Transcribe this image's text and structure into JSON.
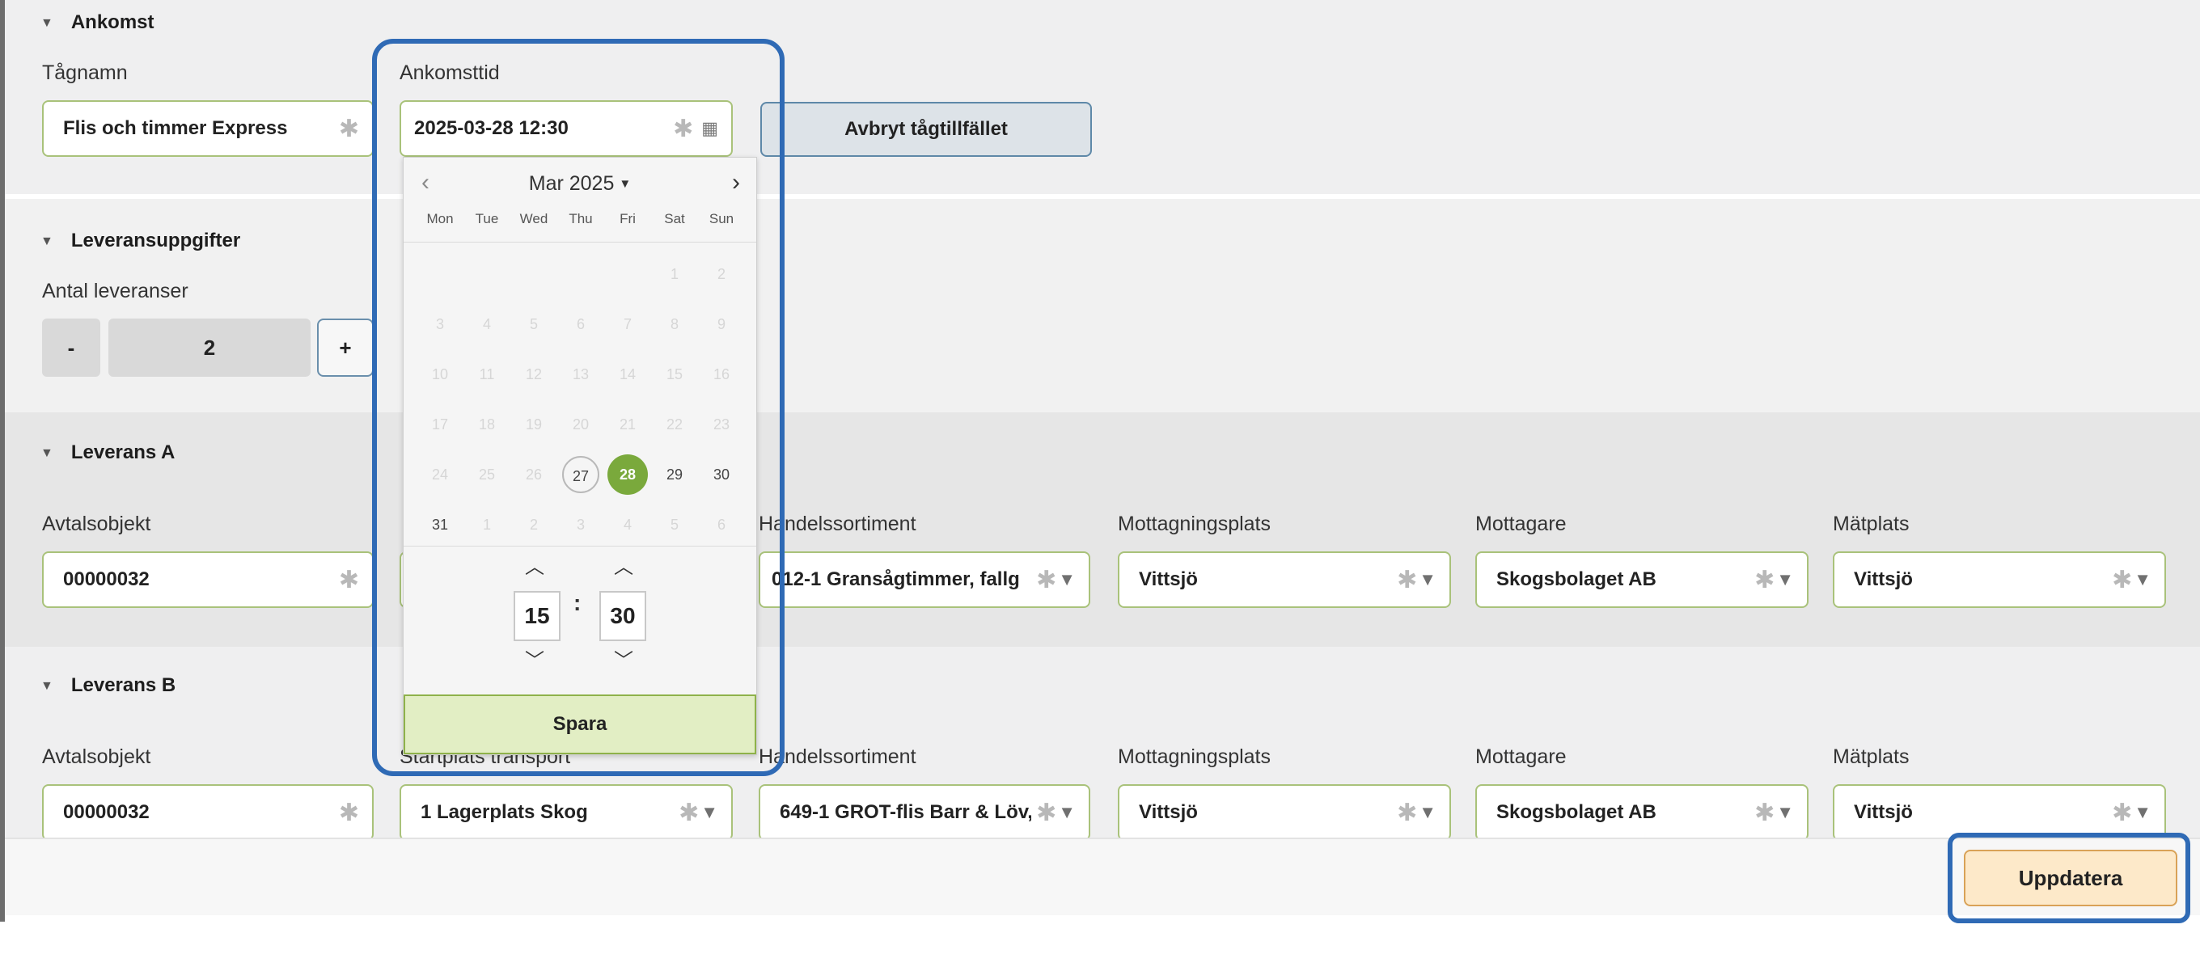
{
  "ankomst": {
    "section_title": "Ankomst",
    "train_name_label": "Tågnamn",
    "train_name_value": "Flis och timmer Express",
    "arrival_time_label": "Ankomsttid",
    "arrival_time_value": "2025-03-28 12:30",
    "cancel_button": "Avbryt tågtillfället"
  },
  "leveransuppgifter": {
    "section_title": "Leveransuppgifter",
    "count_label": "Antal leveranser",
    "minus": "-",
    "count_value": "2",
    "plus": "+"
  },
  "leverans_a": {
    "section_title": "Leverans A",
    "avtalsobjekt_label": "Avtalsobjekt",
    "avtalsobjekt_value": "00000032",
    "handelssortiment_label": "Handelssortiment",
    "handelssortiment_value": "012-1 Gransågtimmer, fallg",
    "mottagningsplats_label": "Mottagningsplats",
    "mottagningsplats_value": "Vittsjö",
    "mottagare_label": "Mottagare",
    "mottagare_value": "Skogsbolaget AB",
    "matplats_label": "Mätplats",
    "matplats_value": "Vittsjö"
  },
  "leverans_b": {
    "section_title": "Leverans B",
    "avtalsobjekt_label": "Avtalsobjekt",
    "avtalsobjekt_value": "00000032",
    "startplats_label": "Startplats transport",
    "startplats_value": "1 Lagerplats Skog",
    "handelssortiment_label": "Handelssortiment",
    "handelssortiment_value": "649-1 GROT-flis Barr & Löv,",
    "mottagningsplats_label": "Mottagningsplats",
    "mottagningsplats_value": "Vittsjö",
    "mottagare_label": "Mottagare",
    "mottagare_value": "Skogsbolaget AB",
    "matplats_label": "Mätplats",
    "matplats_value": "Vittsjö"
  },
  "footer": {
    "update_button": "Uppdatera"
  },
  "datepicker": {
    "month_label": "Mar 2025",
    "weekdays": [
      "Mon",
      "Tue",
      "Wed",
      "Thu",
      "Fri",
      "Sat",
      "Sun"
    ],
    "rows": [
      [
        "",
        "",
        "",
        "",
        "",
        "1",
        "2"
      ],
      [
        "3",
        "4",
        "5",
        "6",
        "7",
        "8",
        "9"
      ],
      [
        "10",
        "11",
        "12",
        "13",
        "14",
        "15",
        "16"
      ],
      [
        "17",
        "18",
        "19",
        "20",
        "21",
        "22",
        "23"
      ],
      [
        "24",
        "25",
        "26",
        "27",
        "28",
        "29",
        "30"
      ],
      [
        "31",
        "1",
        "2",
        "3",
        "4",
        "5",
        "6"
      ]
    ],
    "today": "27",
    "selected": "28",
    "hour": "15",
    "minute": "30",
    "save_button": "Spara"
  },
  "icons": {
    "required": "asterisk-icon",
    "dropdown": "caret-down-icon",
    "calendar": "calendar-icon",
    "collapse": "triangle-down-icon"
  },
  "colors": {
    "field_border": "#a9c27a",
    "selected_day": "#7aa93c",
    "highlight": "#2f6ab5",
    "update_bg": "#fde9c9"
  }
}
